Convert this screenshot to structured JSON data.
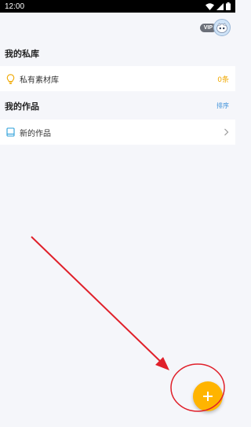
{
  "status_bar": {
    "time": "12:00"
  },
  "header": {
    "vip_label": "VIP"
  },
  "private_library": {
    "section_title": "我的私库",
    "item_label": "私有素材库",
    "item_count": "0条"
  },
  "my_works": {
    "section_title": "我的作品",
    "sort_label": "排序",
    "item_label": "新的作品"
  },
  "colors": {
    "accent": "#ffb400",
    "link": "#3a8fd9",
    "annotation": "#e0202a"
  }
}
